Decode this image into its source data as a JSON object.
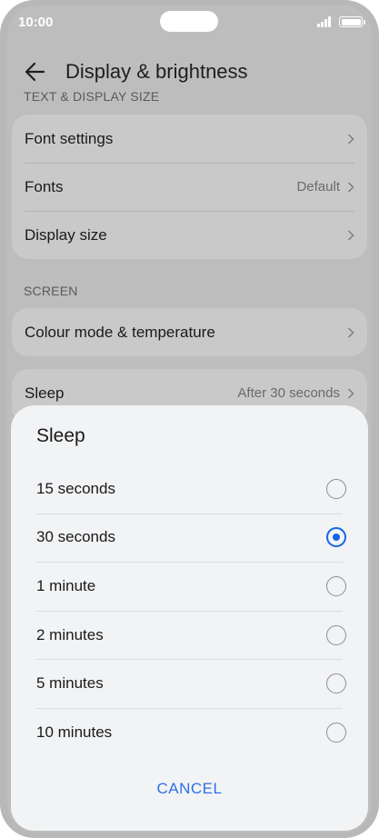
{
  "status_bar": {
    "time": "10:00"
  },
  "header": {
    "title": "Display & brightness",
    "back_icon": "arrow-left-icon"
  },
  "sections": {
    "text_display_label": "TEXT & DISPLAY SIZE",
    "text_display_items": [
      {
        "label": "Font settings",
        "value": ""
      },
      {
        "label": "Fonts",
        "value": "Default"
      },
      {
        "label": "Display size",
        "value": ""
      }
    ],
    "screen_label": "SCREEN",
    "screen_items": [
      {
        "label": "Colour mode & temperature",
        "value": ""
      }
    ],
    "sleep_item": {
      "label": "Sleep",
      "value": "After 30 seconds"
    }
  },
  "dialog": {
    "title": "Sleep",
    "options": [
      {
        "label": "15 seconds",
        "selected": false
      },
      {
        "label": "30 seconds",
        "selected": true
      },
      {
        "label": "1 minute",
        "selected": false
      },
      {
        "label": "2 minutes",
        "selected": false
      },
      {
        "label": "5 minutes",
        "selected": false
      },
      {
        "label": "10 minutes",
        "selected": false
      }
    ],
    "cancel_label": "CANCEL"
  },
  "colors": {
    "accent": "#1565e6",
    "cancel_text": "#2f6fe6"
  }
}
